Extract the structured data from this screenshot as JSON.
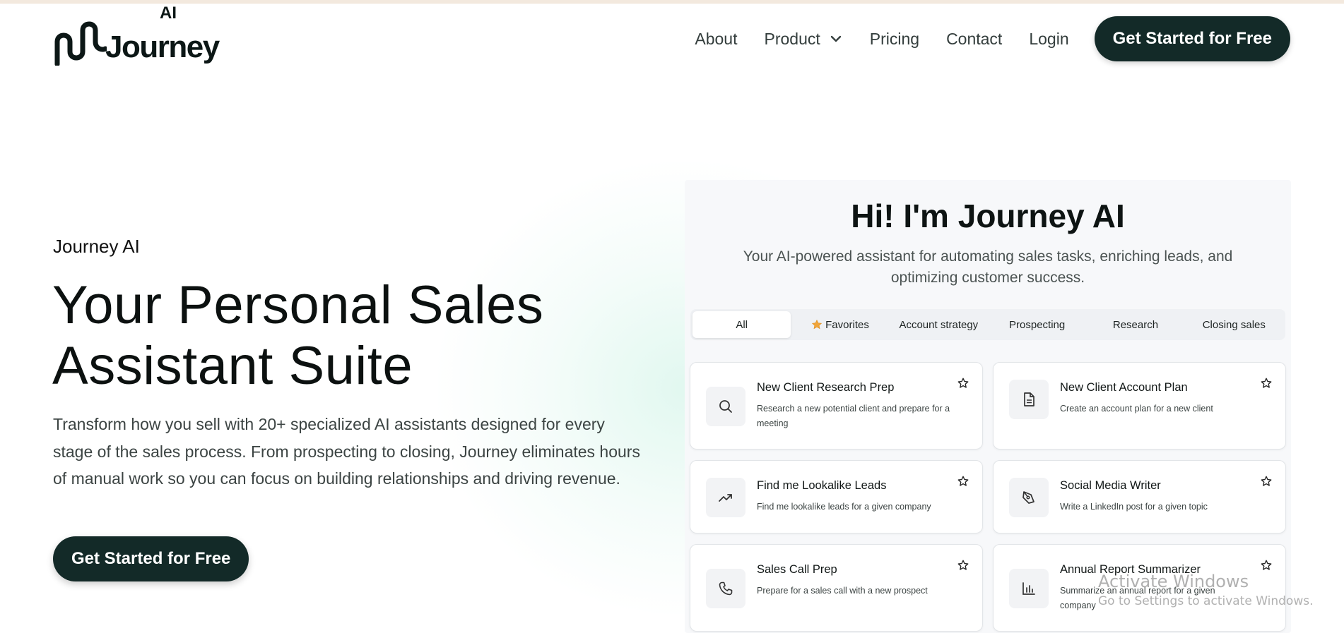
{
  "brand": {
    "wordmark": "Journey",
    "superscript": "AI"
  },
  "nav": {
    "links": [
      "About",
      "Product",
      "Pricing",
      "Contact",
      "Login"
    ],
    "cta_label": "Get Started for Free"
  },
  "hero": {
    "eyebrow": "Journey AI",
    "title_line1": "Your Personal Sales",
    "title_line2": "Assistant Suite",
    "subtitle": "Transform how you sell with 20+ specialized AI assistants designed for every stage of the sales process. From prospecting to closing, Journey eliminates hours of manual work so you can focus on building relationships and driving revenue.",
    "cta_label": "Get Started for Free"
  },
  "panel": {
    "title": "Hi! I'm Journey AI",
    "subtitle": "Your AI-powered assistant for automating sales tasks, enriching leads, and optimizing customer success.",
    "tabs": [
      "All",
      "Favorites",
      "Account strategy",
      "Prospecting",
      "Research",
      "Closing sales"
    ],
    "active_tab": "All",
    "cards": [
      {
        "title": "New Client Research Prep",
        "desc": "Research a new potential client and prepare for a meeting",
        "icon": "search-icon"
      },
      {
        "title": "New Client Account Plan",
        "desc": "Create an account plan for a new client",
        "icon": "document-icon"
      },
      {
        "title": "Find me Lookalike Leads",
        "desc": "Find me lookalike leads for a given company",
        "icon": "trending-up-icon"
      },
      {
        "title": "Social Media Writer",
        "desc": "Write a LinkedIn post for a given topic",
        "icon": "pen-tool-icon"
      },
      {
        "title": "Sales Call Prep",
        "desc": "Prepare for a sales call with a new prospect",
        "icon": "phone-icon"
      },
      {
        "title": "Annual Report Summarizer",
        "desc": "Summarize an annual report for a given company",
        "icon": "bar-chart-icon"
      }
    ]
  },
  "watermark": {
    "title": "Activate Windows",
    "subtitle": "Go to Settings to activate Windows."
  },
  "colors": {
    "primary_dark": "#132a28",
    "favorite_star": "#f0a53a",
    "panel_bg": "#f7f8fa"
  }
}
